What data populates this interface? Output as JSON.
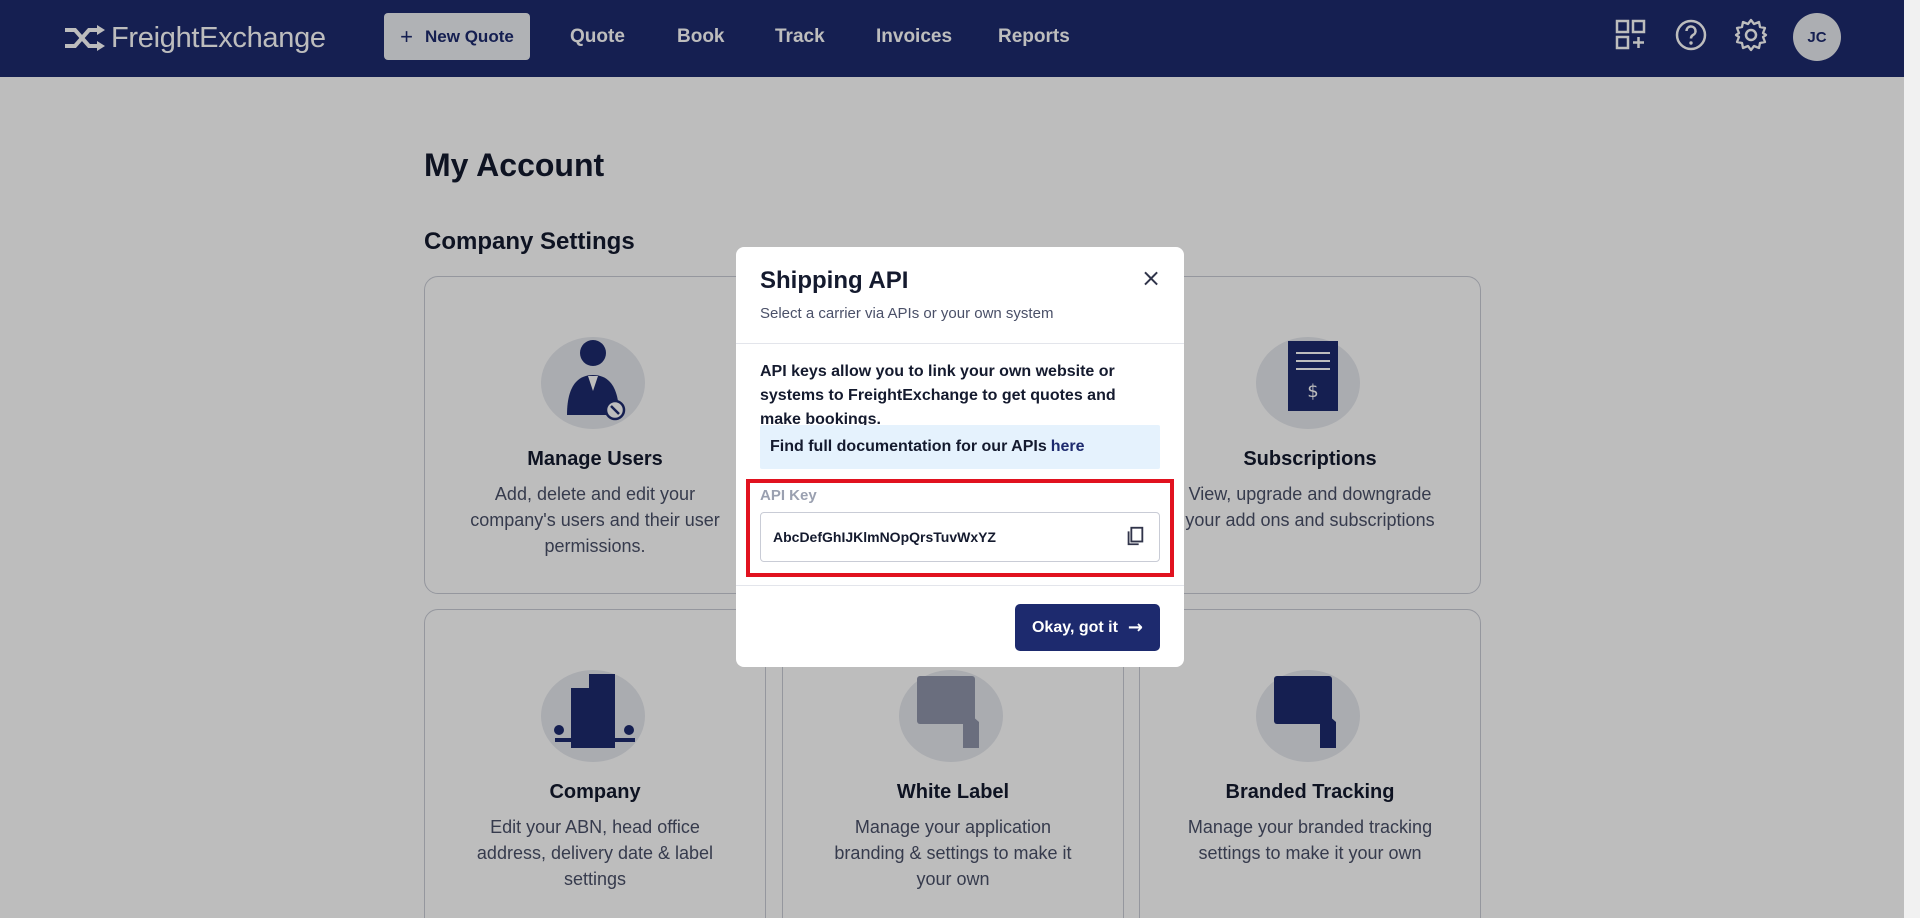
{
  "header": {
    "logo_text": "FreightExchange",
    "new_quote_label": "New Quote",
    "nav": [
      "Quote",
      "Book",
      "Track",
      "Invoices",
      "Reports"
    ],
    "avatar_initials": "JC"
  },
  "page": {
    "title": "My Account",
    "section_title": "Company Settings"
  },
  "cards": [
    {
      "title": "Manage Users",
      "description": "Add, delete and edit your company's users and their user permissions."
    },
    {
      "title": "Subscriptions",
      "description": "View, upgrade and downgrade your add ons and subscriptions"
    },
    {
      "title": "Company",
      "description": "Edit your ABN, head office address, delivery date & label settings"
    },
    {
      "title": "White Label",
      "description": "Manage your application branding & settings to make it your own"
    },
    {
      "title": "Branded Tracking",
      "description": "Manage your branded tracking settings to make it your own"
    }
  ],
  "modal": {
    "title": "Shipping API",
    "subtitle": "Select a carrier via APIs or your own system",
    "close_symbol": "×",
    "body_text": "API keys allow you to link your own website or systems to FreightExchange to get quotes and make bookings.",
    "doc_text": "Find full documentation for our APIs",
    "doc_link": "here",
    "api_key_label": "API Key",
    "api_key_value": "AbcDefGhIJKlmNOpQrsTuvWxYZ",
    "ok_label": "Okay, got it",
    "ok_arrow": "→"
  },
  "colors": {
    "brand_navy": "#1d2a6e",
    "highlight_red": "#e1121f",
    "info_blue": "#e5f2fd"
  }
}
